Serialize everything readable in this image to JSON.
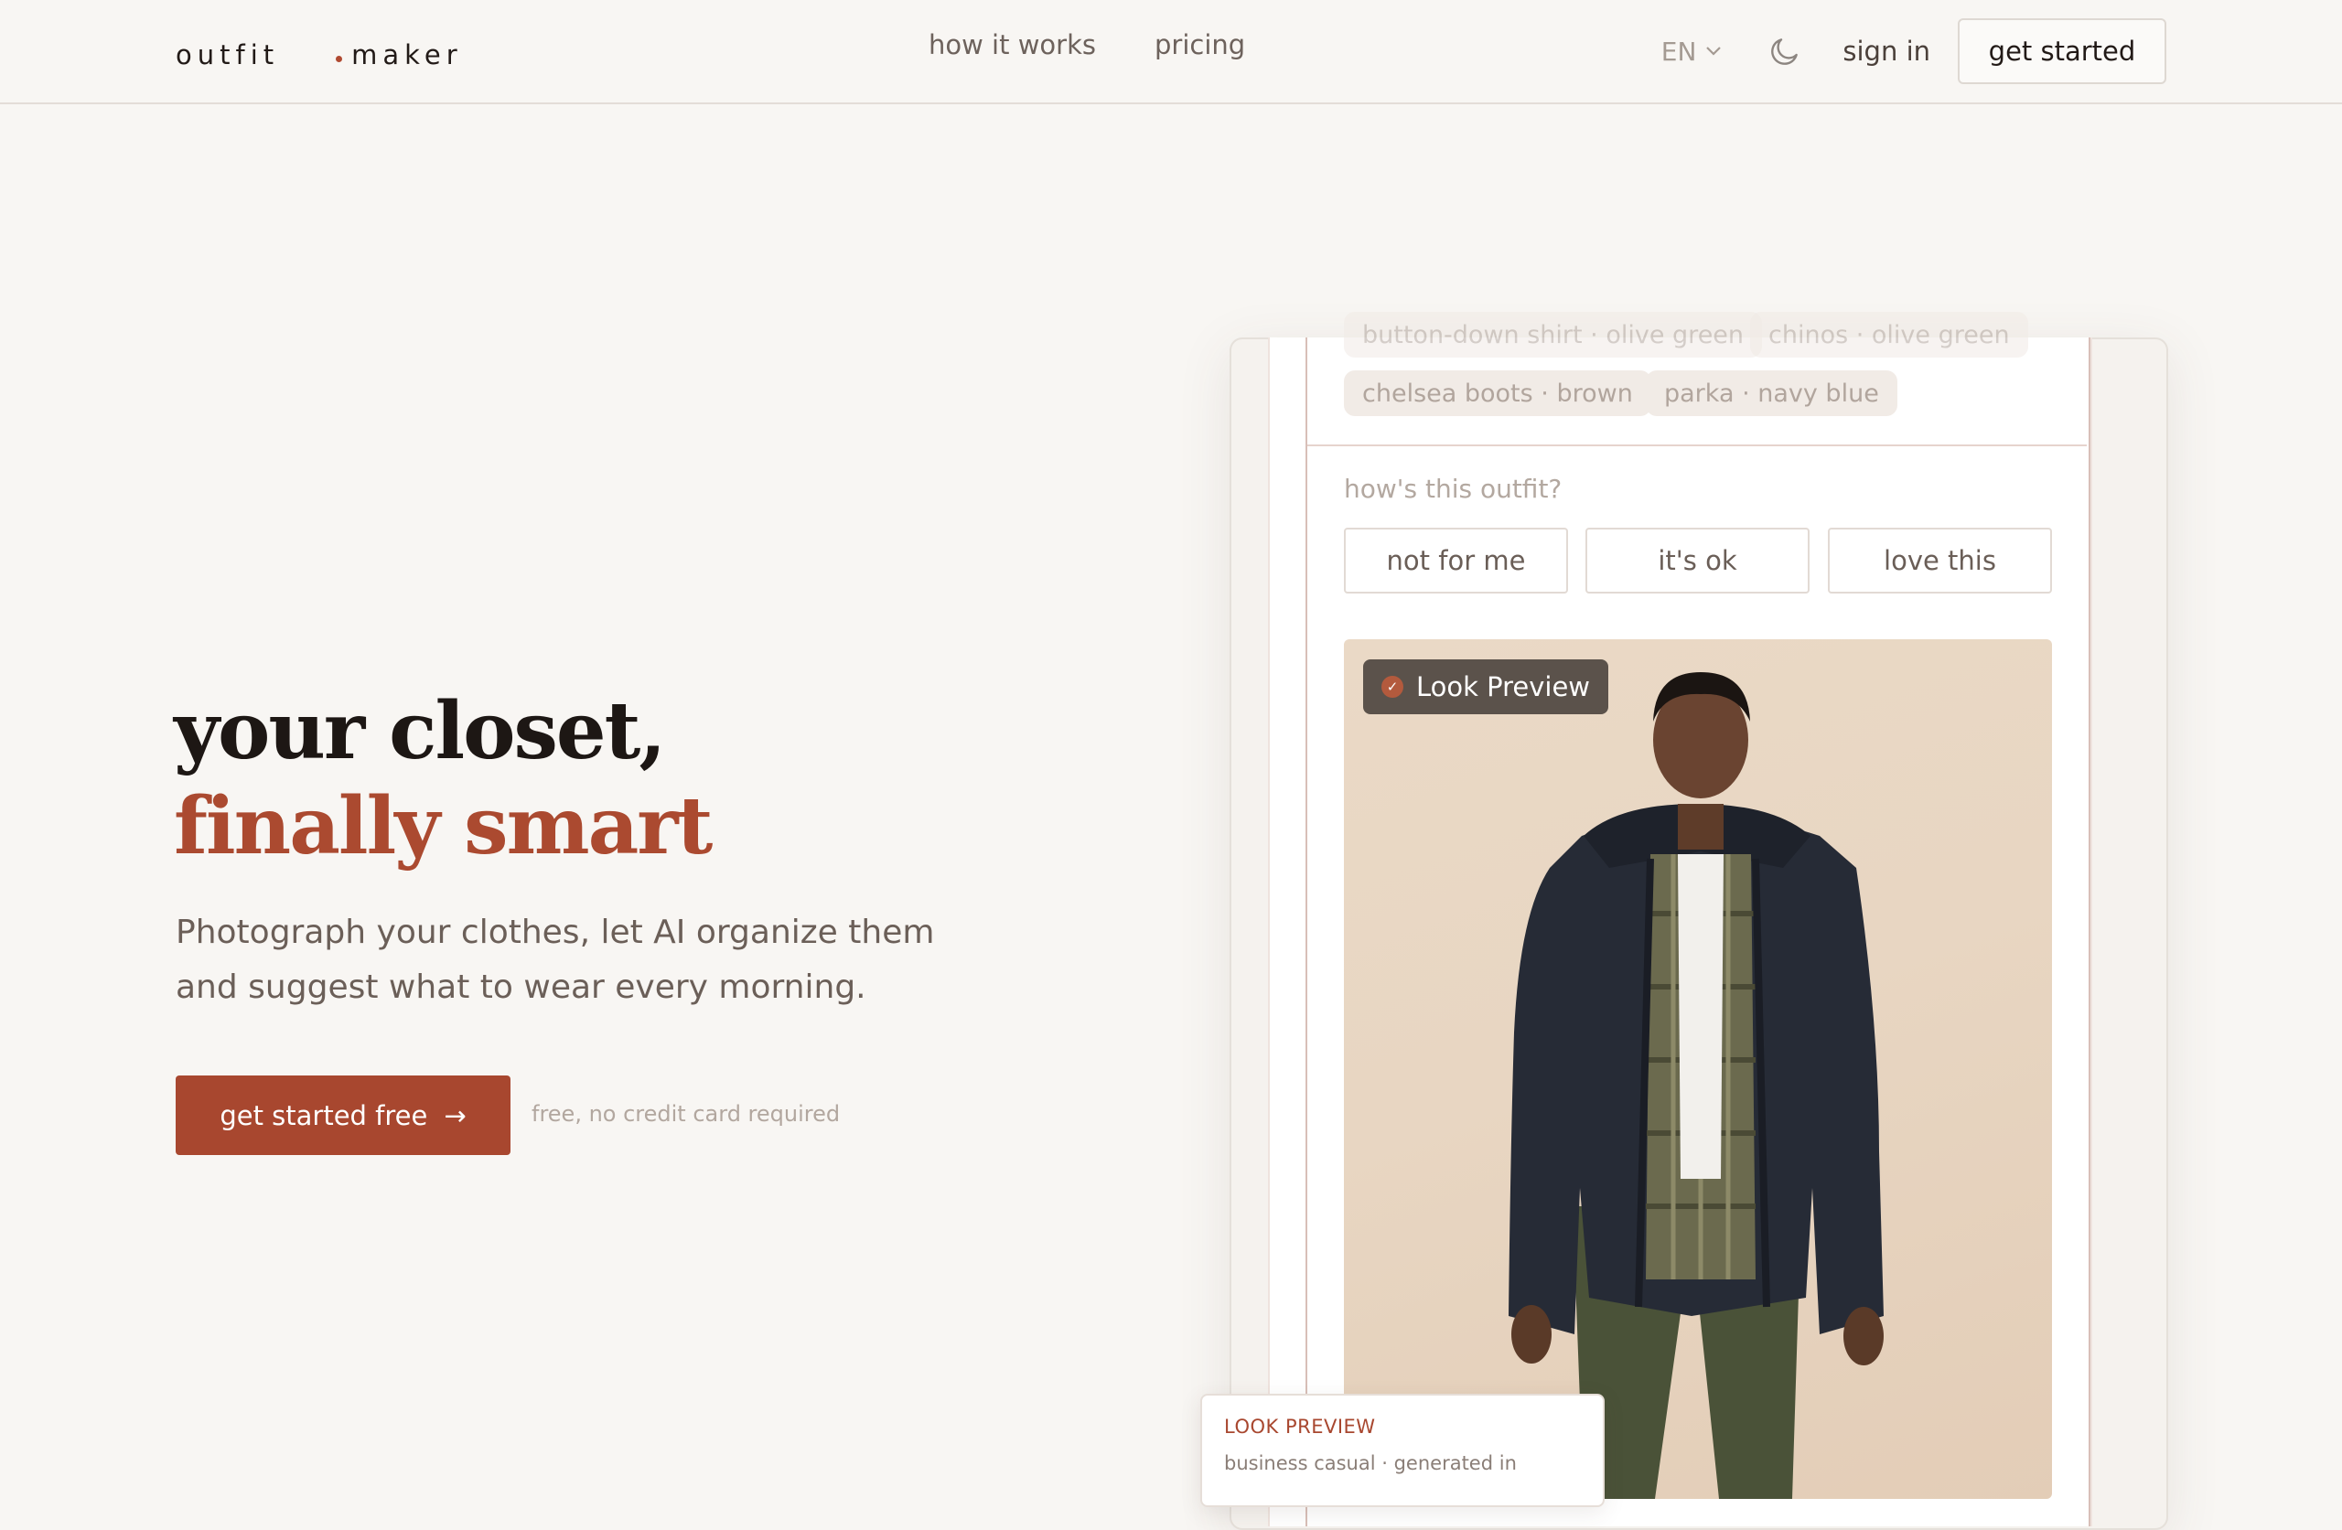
{
  "brand": {
    "word1": "outfit",
    "word2": "maker"
  },
  "nav": {
    "links": [
      "how it works",
      "pricing"
    ],
    "language": "EN",
    "sign_in": "sign in",
    "get_started": "get started"
  },
  "hero": {
    "title_line1": "your closet,",
    "title_line2": "finally smart",
    "subtitle": "Photograph your clothes, let AI organize them and suggest what to wear every morning.",
    "cta": "get started free",
    "cta_arrow": "→",
    "note": "free, no credit card required"
  },
  "mockup": {
    "chips_top": [
      "button-down shirt · olive green",
      "chinos · olive green"
    ],
    "chips": [
      "chelsea boots · brown",
      "parka · navy blue"
    ],
    "question": "how's this outfit?",
    "ratings": [
      "not for me",
      "it's ok",
      "love this"
    ],
    "badge": "Look Preview",
    "badge_icon": "check-icon",
    "tooltip_title": "LOOK PREVIEW",
    "tooltip_text": "business casual · generated in"
  },
  "colors": {
    "accent": "#a8472f",
    "background": "#f8f6f3",
    "text": "#1d1714"
  }
}
